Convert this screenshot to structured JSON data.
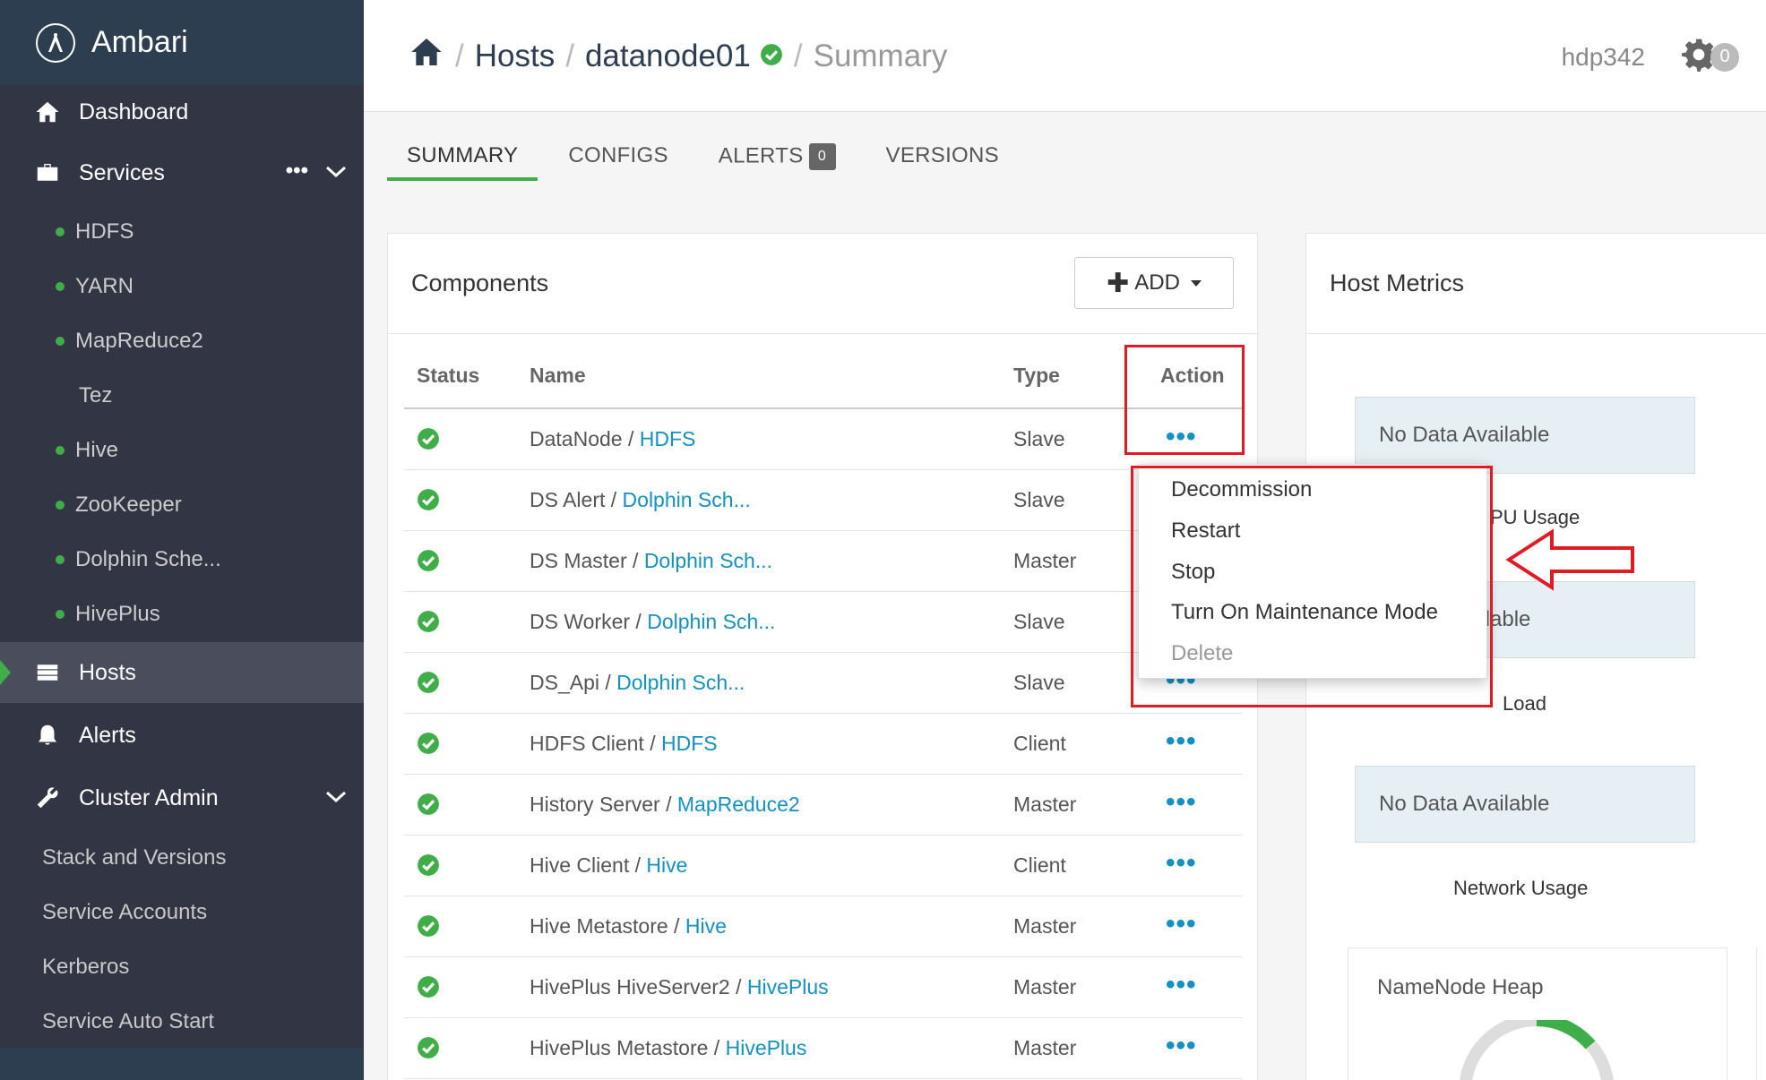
{
  "brand": {
    "name": "Ambari"
  },
  "sidebar": {
    "dashboard": "Dashboard",
    "services": "Services",
    "services_more": "•••",
    "services_list": [
      "HDFS",
      "YARN",
      "MapReduce2",
      "Tez",
      "Hive",
      "ZooKeeper",
      "Dolphin Sche...",
      "HivePlus"
    ],
    "hosts": "Hosts",
    "alerts": "Alerts",
    "cluster_admin": "Cluster Admin",
    "cluster_admin_items": [
      "Stack and Versions",
      "Service Accounts",
      "Kerberos",
      "Service Auto Start"
    ]
  },
  "header": {
    "breadcrumb_hosts": "Hosts",
    "breadcrumb_host": "datanode01",
    "breadcrumb_summary": "Summary",
    "separator": "/",
    "cluster": "hdp342",
    "ops_count": "0"
  },
  "tabs": {
    "summary": "SUMMARY",
    "configs": "CONFIGS",
    "alerts": "ALERTS",
    "alerts_count": "0",
    "versions": "VERSIONS"
  },
  "components": {
    "title": "Components",
    "add_label": "ADD",
    "headers": {
      "status": "Status",
      "name": "Name",
      "type": "Type",
      "action": "Action"
    },
    "rows": [
      {
        "name": "DataNode / ",
        "service": "HDFS",
        "type": "Slave"
      },
      {
        "name": "DS Alert / ",
        "service": "Dolphin Sch...",
        "type": "Slave"
      },
      {
        "name": "DS Master / ",
        "service": "Dolphin Sch...",
        "type": "Master"
      },
      {
        "name": "DS Worker / ",
        "service": "Dolphin Sch...",
        "type": "Slave"
      },
      {
        "name": "DS_Api / ",
        "service": "Dolphin Sch...",
        "type": "Slave"
      },
      {
        "name": "HDFS Client / ",
        "service": "HDFS",
        "type": "Client"
      },
      {
        "name": "History Server / ",
        "service": "MapReduce2",
        "type": "Master"
      },
      {
        "name": "Hive Client / ",
        "service": "Hive",
        "type": "Client"
      },
      {
        "name": "Hive Metastore / ",
        "service": "Hive",
        "type": "Master"
      },
      {
        "name": "HivePlus HiveServer2 / ",
        "service": "HivePlus",
        "type": "Master"
      },
      {
        "name": "HivePlus Metastore / ",
        "service": "HivePlus",
        "type": "Master"
      }
    ],
    "action_glyph": "•••"
  },
  "action_menu": {
    "items": [
      "Decommission",
      "Restart",
      "Stop",
      "Turn On Maintenance Mode",
      "Delete"
    ]
  },
  "metrics": {
    "title": "Host Metrics",
    "no_data": "No Data Available",
    "cpu_label_partial": "PU Usage",
    "no_data_partial": "ailable",
    "load_label": "Load",
    "network_label": "Network Usage",
    "heap_title": "NameNode Heap"
  },
  "colors": {
    "sidebar": "#323544",
    "accent": "#3fae49",
    "link": "#1491c1",
    "highlight": "#e01b24"
  }
}
